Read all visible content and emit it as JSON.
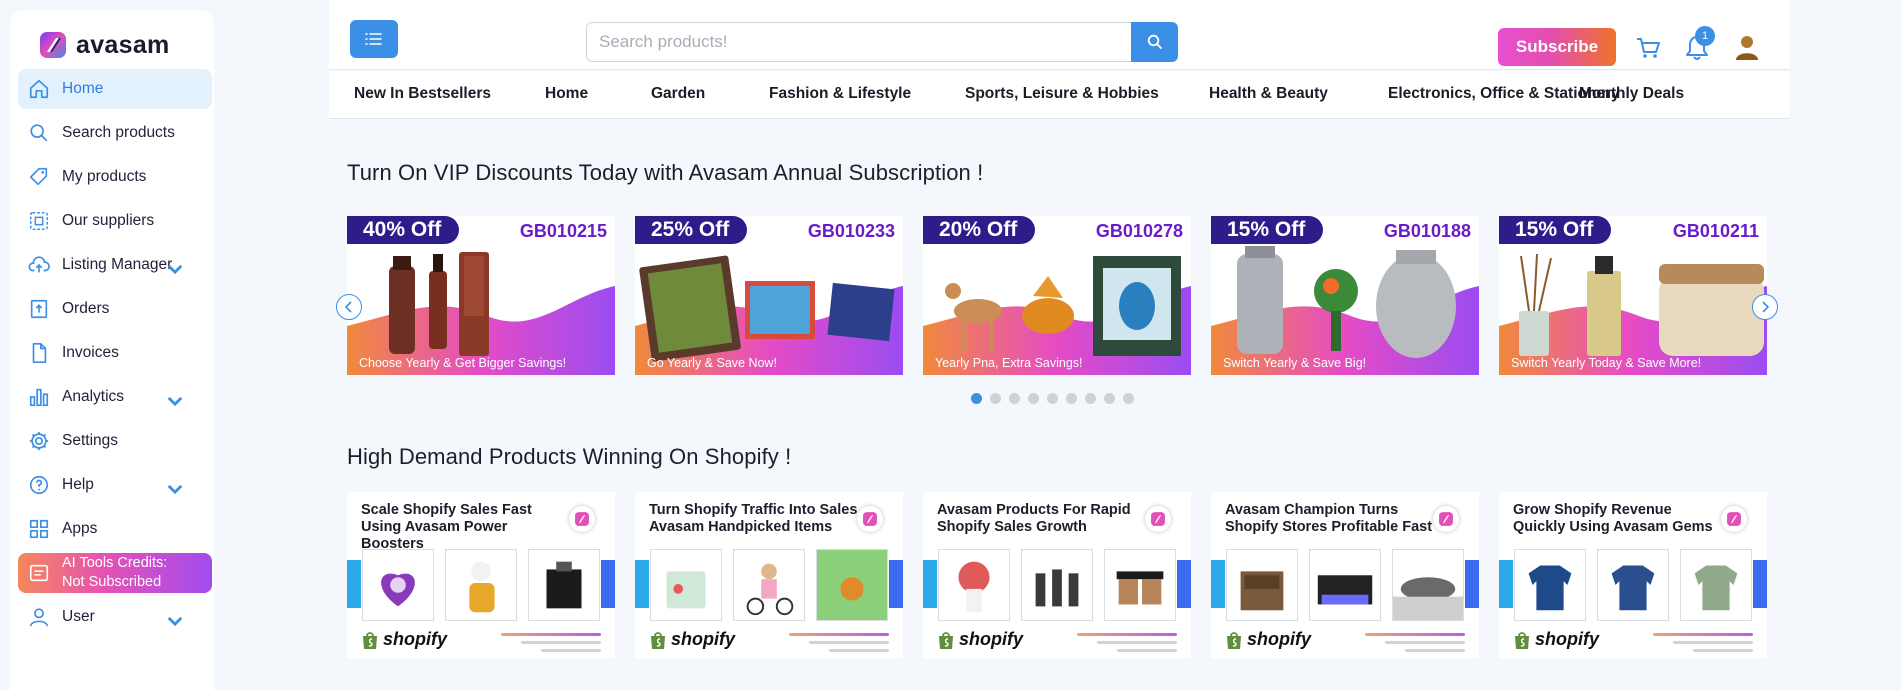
{
  "app": {
    "name": "avasam"
  },
  "sidebar": {
    "items": [
      {
        "label": "Home",
        "icon": "home-icon",
        "active": true,
        "expandable": false
      },
      {
        "label": "Search products",
        "icon": "search-icon",
        "expandable": false
      },
      {
        "label": "My products",
        "icon": "tag-icon",
        "expandable": false
      },
      {
        "label": "Our suppliers",
        "icon": "suppliers-icon",
        "expandable": false
      },
      {
        "label": "Listing Manager",
        "icon": "cloud-upload-icon",
        "expandable": true
      },
      {
        "label": "Orders",
        "icon": "orders-box-icon",
        "expandable": false
      },
      {
        "label": "Invoices",
        "icon": "invoice-icon",
        "expandable": false
      },
      {
        "label": "Analytics",
        "icon": "bar-chart-icon",
        "expandable": true
      },
      {
        "label": "Settings",
        "icon": "gear-icon",
        "expandable": false
      },
      {
        "label": "Help",
        "icon": "help-icon",
        "expandable": true
      },
      {
        "label": "Apps",
        "icon": "apps-grid-icon",
        "expandable": false
      }
    ],
    "ai_credits": {
      "line1": "AI Tools Credits:",
      "line2": "Not Subscribed"
    },
    "user": {
      "label": "User",
      "icon": "user-icon"
    }
  },
  "header": {
    "search_placeholder": "Search products!",
    "subscribe_label": "Subscribe",
    "notification_count": "1"
  },
  "categories": [
    "New In Bestsellers",
    "Home",
    "Garden",
    "Fashion & Lifestyle",
    "Sports, Leisure & Hobbies",
    "Health & Beauty",
    "Electronics, Office & Stationery",
    "Monthly Deals"
  ],
  "vip_section": {
    "title": "Turn On VIP Discounts Today with Avasam Annual Subscription !",
    "banners": [
      {
        "discount": "40% Off",
        "code": "GB010215",
        "caption": "Choose Yearly & Get Bigger Savings!"
      },
      {
        "discount": "25% Off",
        "code": "GB010233",
        "caption": "Go Yearly & Save Now!"
      },
      {
        "discount": "20% Off",
        "code": "GB010278",
        "caption": "Yearly Pna, Extra Savings!"
      },
      {
        "discount": "15% Off",
        "code": "GB010188",
        "caption": "Switch Yearly & Save Big!"
      },
      {
        "discount": "15% Off",
        "code": "GB010211",
        "caption": "Switch Yearly Today & Save More!"
      }
    ],
    "carousel_page_count": 9,
    "carousel_active_index": 0
  },
  "shopify_section": {
    "title": "High Demand Products Winning On Shopify !",
    "brand_text": "shopify",
    "cards": [
      {
        "title": "Scale Shopify Sales Fast Using Avasam Power Boosters"
      },
      {
        "title": "Turn Shopify Traffic Into Sales Avasam Handpicked Items"
      },
      {
        "title": "Avasam Products For Rapid Shopify Sales Growth"
      },
      {
        "title": "Avasam Champion Turns Shopify Stores Profitable Fast"
      },
      {
        "title": "Grow Shopify Revenue Quickly Using Avasam Gems"
      }
    ]
  },
  "colors": {
    "accent": "#3c8fe6",
    "badge_purple": "#2d1c8a",
    "code_purple": "#6a1cc8",
    "banner_wave": [
      "#f08a3c",
      "#e64bc6",
      "#9a4cf2"
    ]
  }
}
